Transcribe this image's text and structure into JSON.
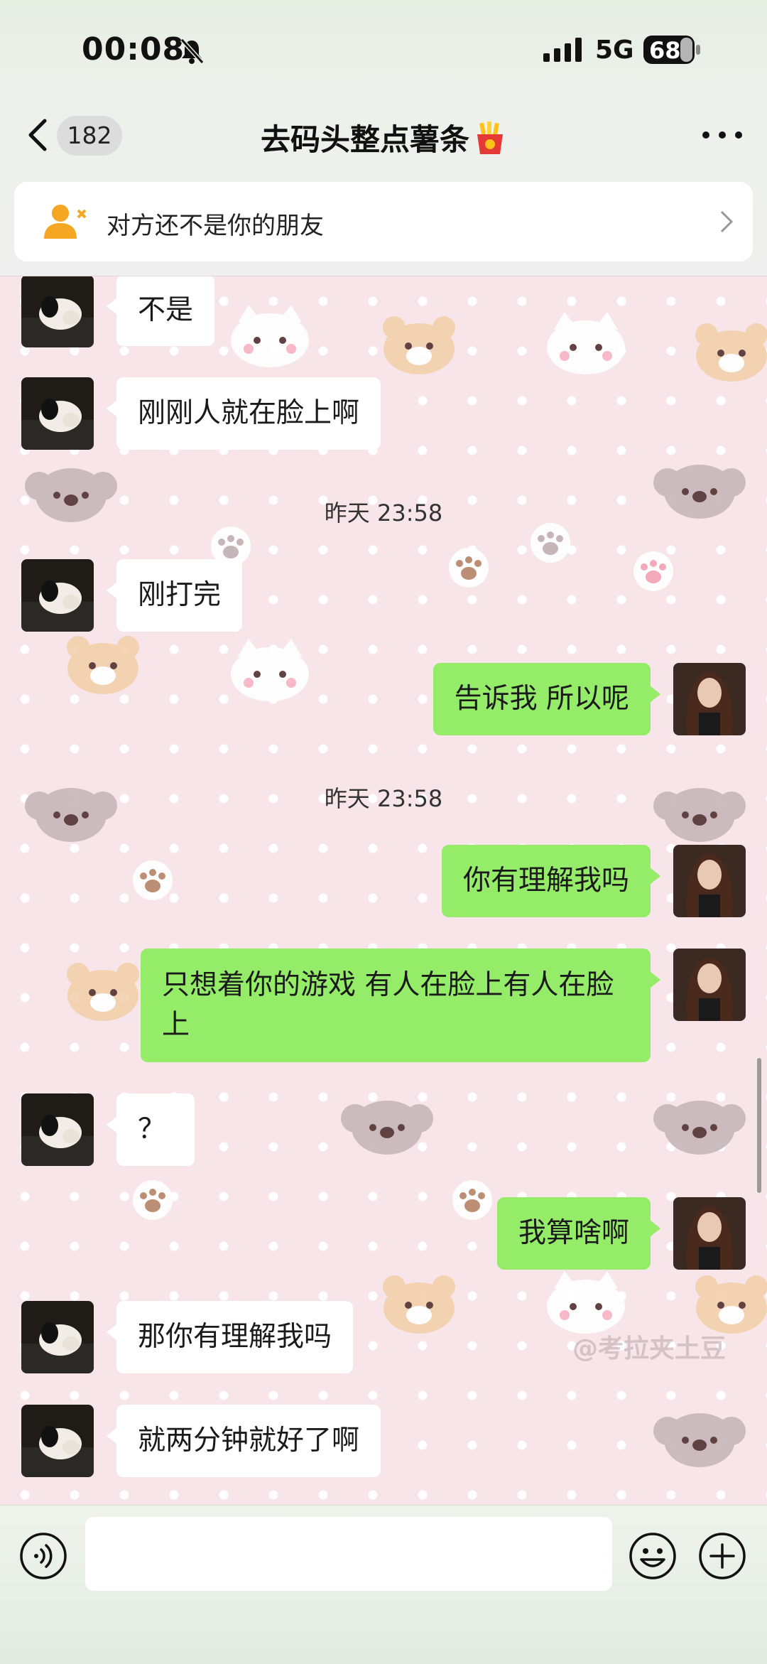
{
  "status_bar": {
    "time": "00:08",
    "network": "5G",
    "battery": "68"
  },
  "header": {
    "back_count": "182",
    "title": "去码头整点薯条",
    "title_emoji_icon": "french-fries-icon",
    "notice_text": "对方还不是你的朋友"
  },
  "messages": [
    {
      "side": "in",
      "text": "不是"
    },
    {
      "side": "in",
      "text": "刚刚人就在脸上啊"
    },
    {
      "type": "time",
      "text": "昨天 23:58"
    },
    {
      "side": "in",
      "text": "刚打完"
    },
    {
      "side": "out",
      "text": "告诉我  所以呢"
    },
    {
      "type": "time",
      "text": "昨天 23:58"
    },
    {
      "side": "out",
      "text": "你有理解我吗"
    },
    {
      "side": "out",
      "text": "只想着你的游戏  有人在脸上有人在脸上"
    },
    {
      "side": "in",
      "text": "？"
    },
    {
      "side": "out",
      "text": "我算啥啊"
    },
    {
      "side": "in",
      "text": "那你有理解我吗"
    },
    {
      "side": "in",
      "text": "就两分钟就好了啊"
    }
  ],
  "watermark": "@考拉夹土豆",
  "input": {
    "placeholder": ""
  },
  "colors": {
    "outgoing_bubble": "#95ec69",
    "incoming_bubble": "#ffffff",
    "notice_icon": "#f5a623",
    "chat_background": "#f7e5ea"
  }
}
